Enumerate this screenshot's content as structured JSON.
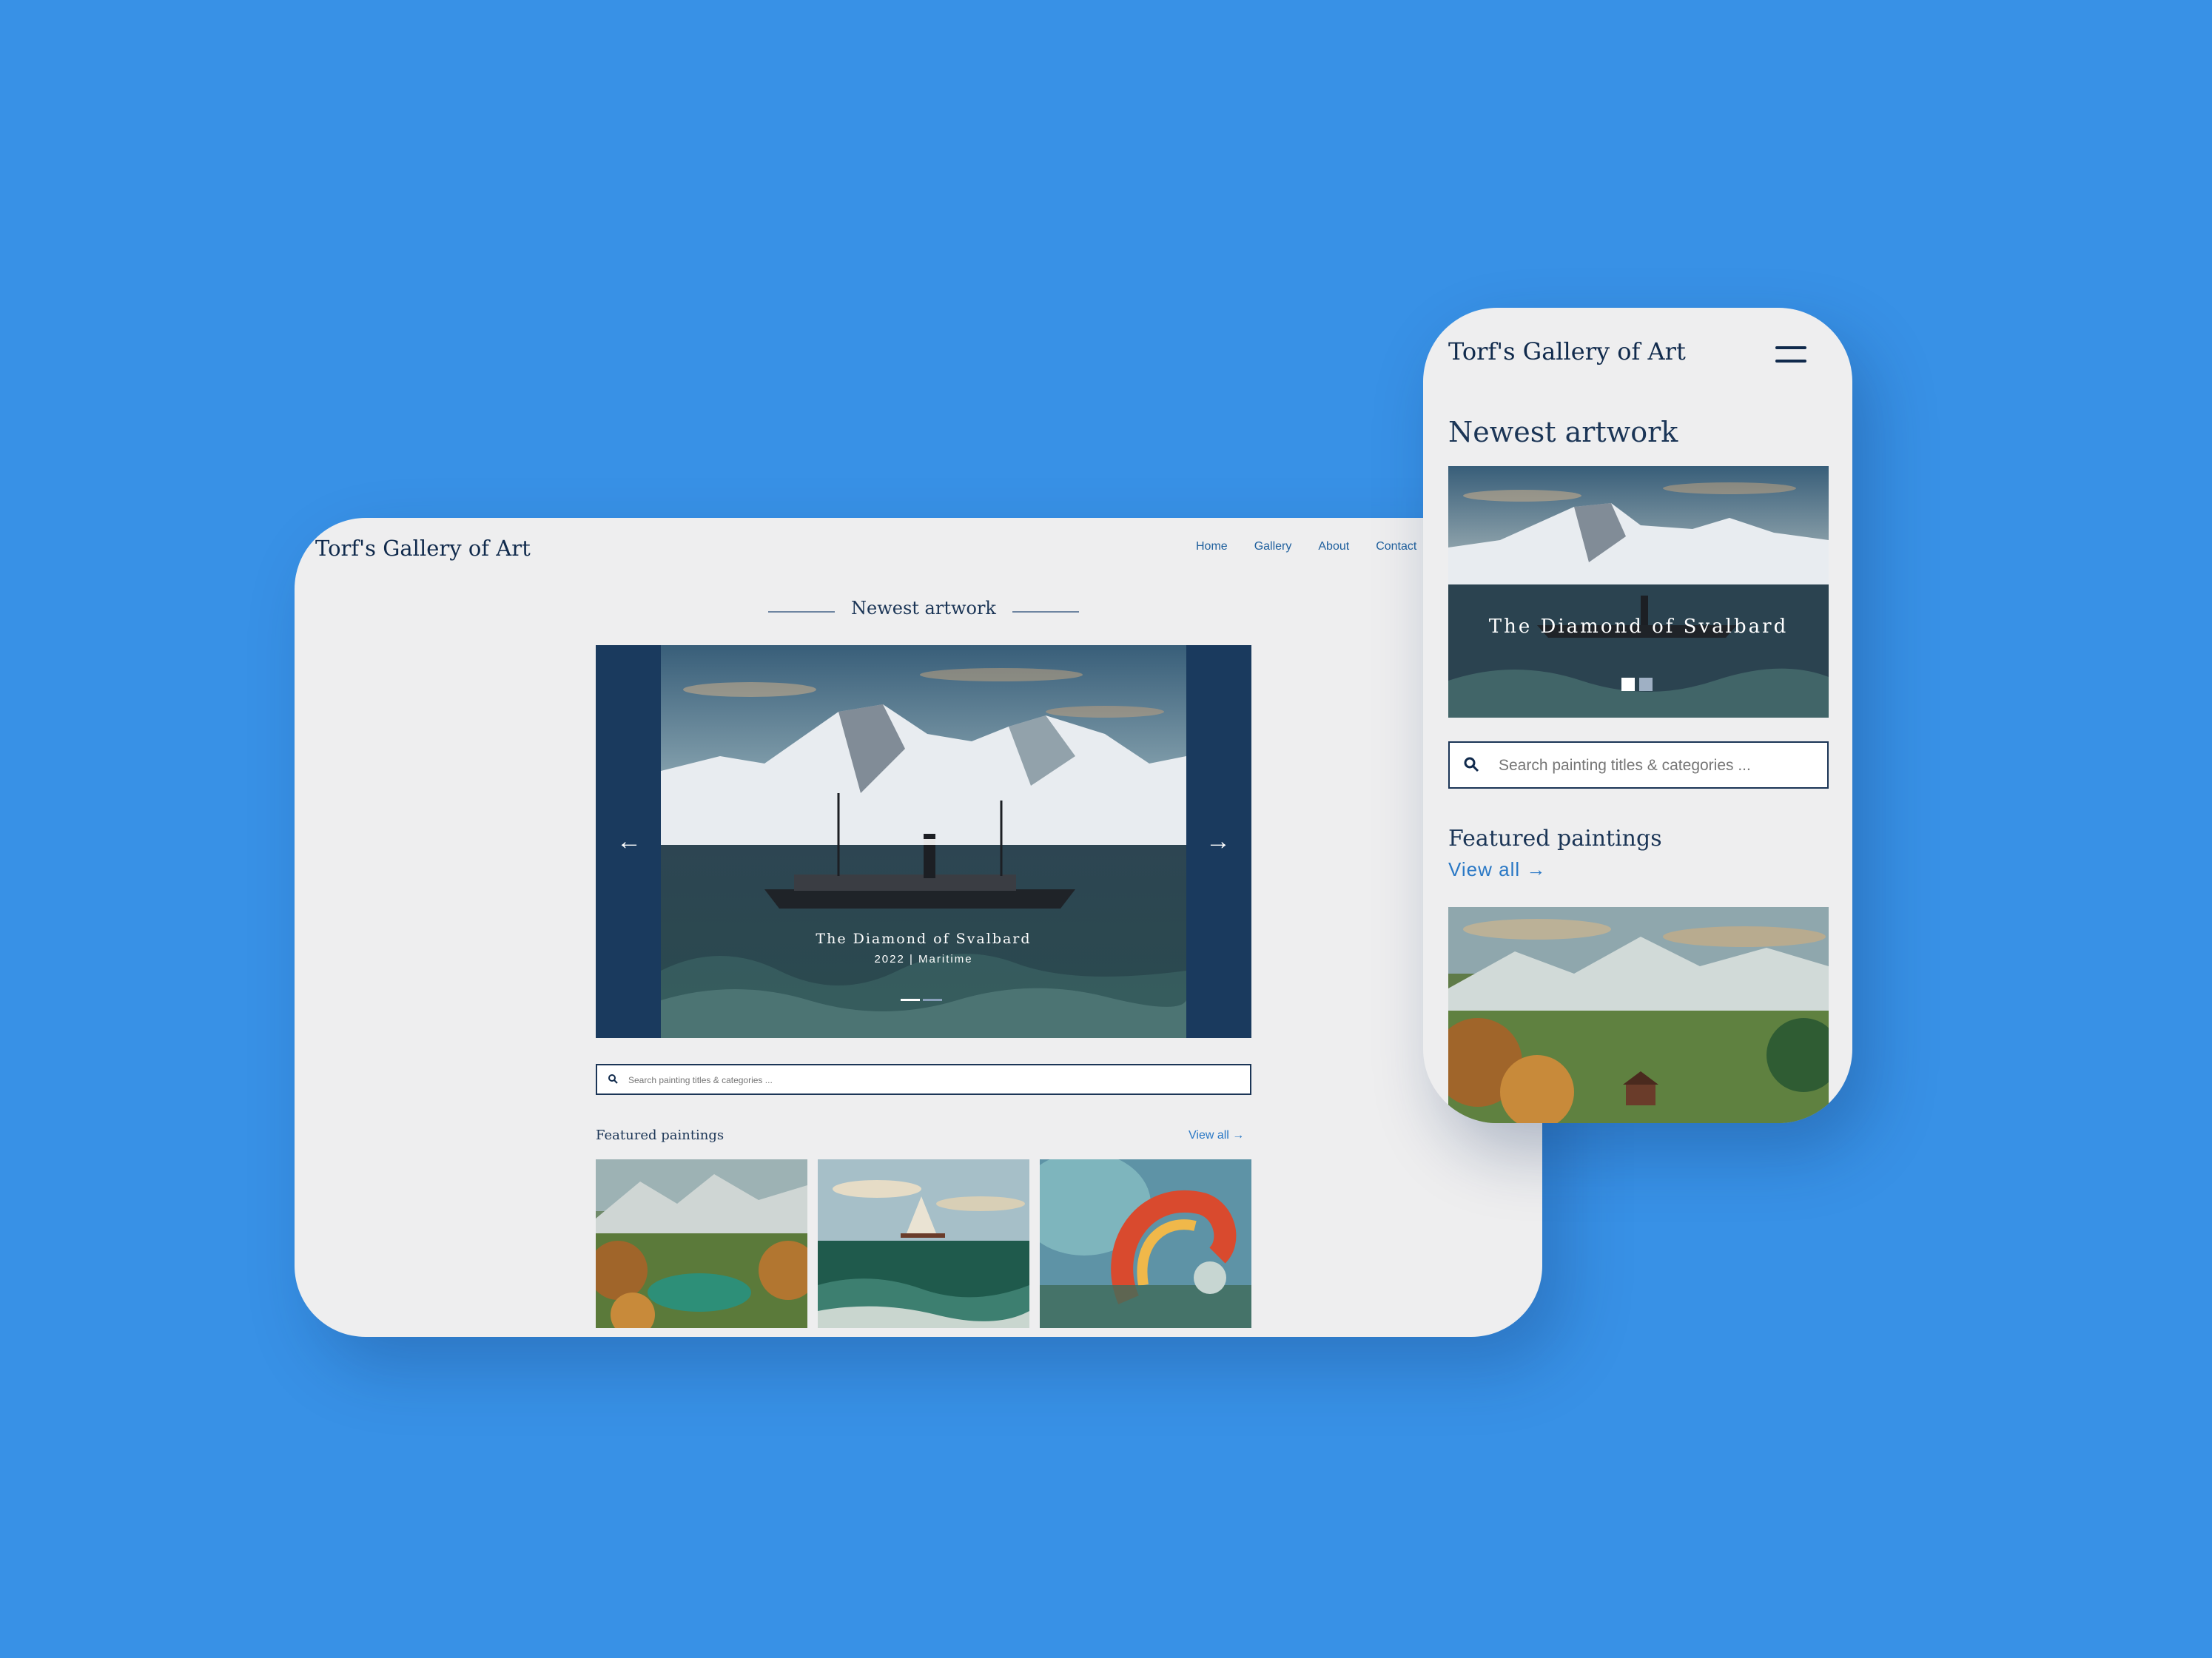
{
  "site": {
    "brand": "Torf's Gallery of Art"
  },
  "desktop": {
    "nav": [
      "Home",
      "Gallery",
      "About",
      "Contact"
    ],
    "newest_heading": "Newest artwork",
    "hero": {
      "title": "The Diamond of Svalbard",
      "subtitle": "2022 | Maritime",
      "active_slide": 1,
      "slide_count": 2,
      "prev_glyph": "←",
      "next_glyph": "→"
    },
    "search_placeholder": "Search painting titles & categories ...",
    "featured_heading": "Featured paintings",
    "view_all": "View all →",
    "featured_count": 3
  },
  "mobile": {
    "newest_heading": "Newest artwork",
    "hero_title": "The Diamond of Svalbard",
    "search_placeholder": "Search painting titles & categories ...",
    "featured_heading": "Featured paintings",
    "view_all": "View all →"
  },
  "icons": [
    "search-icon",
    "arrow-left-icon",
    "arrow-right-icon",
    "hamburger-menu-icon"
  ],
  "colors": {
    "background": "#3891e6",
    "card": "#eeeeef",
    "navy": "#102a4c",
    "link": "#2a78c5"
  }
}
